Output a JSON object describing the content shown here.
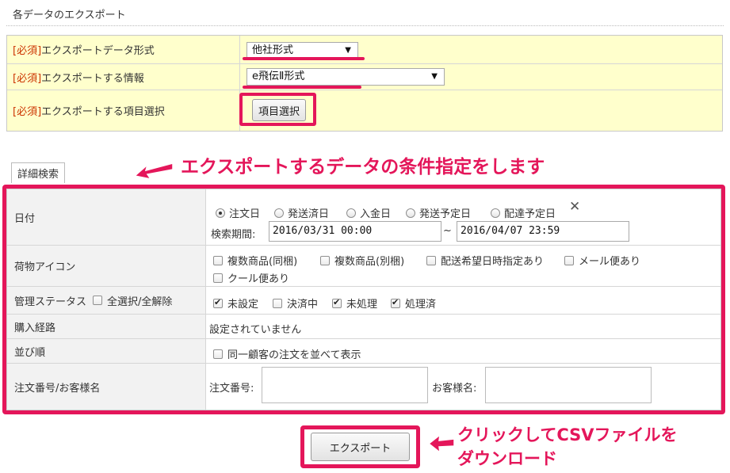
{
  "page": {
    "title": "各データのエクスポート"
  },
  "export_settings": {
    "required_tag": "[必須]",
    "rows": [
      {
        "label": "エクスポートデータ形式",
        "value": "他社形式"
      },
      {
        "label": "エクスポートする情報",
        "value": "e飛伝Ⅱ形式"
      },
      {
        "label": "エクスポートする項目選択",
        "button": "項目選択"
      }
    ]
  },
  "detail_tab": "詳細検索",
  "callouts": {
    "search_note": "エクスポートするデータの条件指定をします",
    "download_note_line1": "クリックしてCSVファイルを",
    "download_note_line2": "ダウンロード"
  },
  "search": {
    "date": {
      "label": "日付",
      "radios": [
        {
          "label": "注文日",
          "checked": true
        },
        {
          "label": "発送済日",
          "checked": false
        },
        {
          "label": "入金日",
          "checked": false
        },
        {
          "label": "発送予定日",
          "checked": false
        },
        {
          "label": "配達予定日",
          "checked": false
        }
      ],
      "clear_icon": "close-icon",
      "period_label": "検索期間:",
      "from": "2016/03/31 00:00",
      "separator": "~",
      "to": "2016/04/07 23:59"
    },
    "parcel_icon": {
      "label": "荷物アイコン",
      "options": [
        {
          "label": "複数商品(同梱)",
          "checked": false
        },
        {
          "label": "複数商品(別梱)",
          "checked": false
        },
        {
          "label": "配送希望日時指定あり",
          "checked": false
        },
        {
          "label": "メール便あり",
          "checked": false
        },
        {
          "label": "クール便あり",
          "checked": false
        }
      ]
    },
    "status": {
      "label": "管理ステータス",
      "select_all": "全選択/全解除",
      "options": [
        {
          "label": "未設定",
          "checked": true
        },
        {
          "label": "決済中",
          "checked": false
        },
        {
          "label": "未処理",
          "checked": true
        },
        {
          "label": "処理済",
          "checked": true
        }
      ]
    },
    "route": {
      "label": "購入経路",
      "value": "設定されていません"
    },
    "sort": {
      "label": "並び順",
      "option": "同一顧客の注文を並べて表示"
    },
    "order_customer": {
      "label": "注文番号/お客様名",
      "order_label": "注文番号:",
      "customer_label": "お客様名:"
    }
  },
  "export_button": "エクスポート",
  "colors": {
    "accent": "#e4165a",
    "required_bg": "#ffffcc",
    "label_bg": "#f2f2f2"
  }
}
